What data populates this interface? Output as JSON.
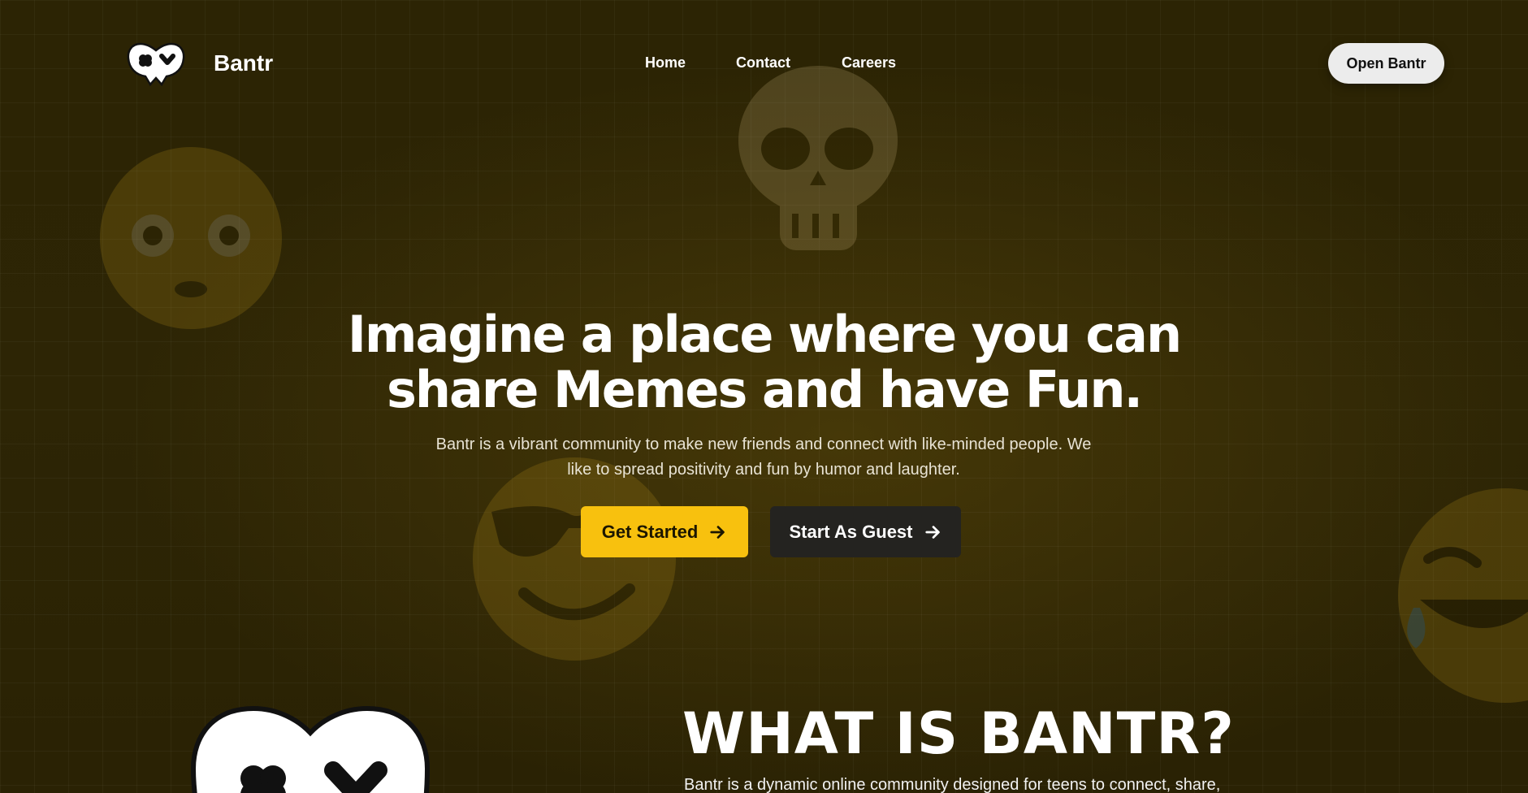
{
  "header": {
    "brand": "Bantr",
    "nav": [
      "Home",
      "Contact",
      "Careers"
    ],
    "cta_label": "Open Bantr"
  },
  "hero": {
    "title_line1": "Imagine a place where you can",
    "title_line2": "share Memes and have Fun.",
    "subtitle": "Bantr is a vibrant community to make new friends and connect with like-minded people. We like to spread positivity and fun by humor and laughter.",
    "primary_button": "Get Started",
    "secondary_button": "Start As Guest"
  },
  "about": {
    "title": "WHAT IS BANTR?",
    "text": "Bantr is a dynamic online community designed for teens to connect, share,"
  },
  "icons": {
    "logo": "bantr-logo-icon",
    "arrow": "arrow-right-icon",
    "decor": [
      "skull-emoji-icon",
      "shocked-face-emoji-icon",
      "sunglasses-face-emoji-icon",
      "laughing-tears-emoji-icon"
    ]
  },
  "colors": {
    "background": "#2a2204",
    "accent_yellow": "#f8c10e",
    "dark_button": "#242320",
    "light_button": "#ececec"
  }
}
